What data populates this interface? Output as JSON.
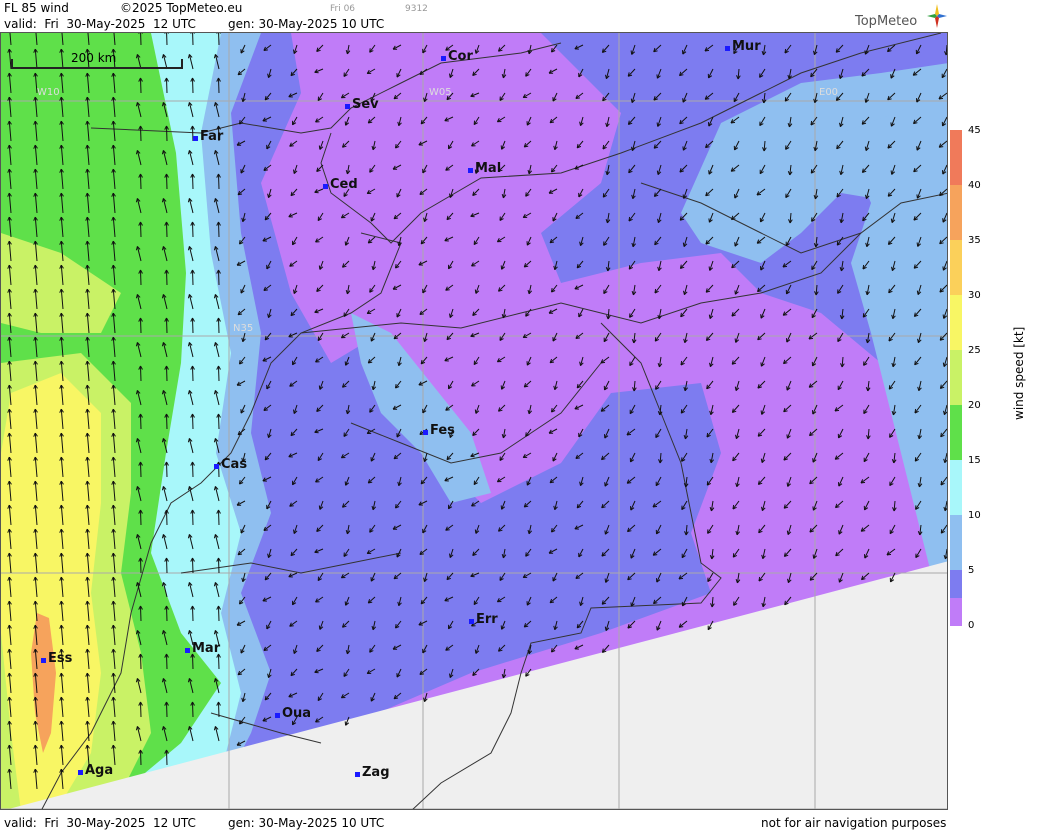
{
  "header": {
    "product": "FL 85 wind",
    "copyright": "©2025 TopMeteo.eu",
    "day_code": "Fri 06",
    "code_number": "9312",
    "valid": "valid:  Fri  30-May-2025  12 UTC",
    "gen": "gen: 30-May-2025 10 UTC"
  },
  "logo": {
    "text": "TopMeteo",
    "icon": "compass-star-icon"
  },
  "scale_bar": {
    "label": "200 km"
  },
  "grid_labels": [
    {
      "text": "W10"
    },
    {
      "text": "W05"
    },
    {
      "text": "E00"
    },
    {
      "text": "N35"
    }
  ],
  "cities": [
    {
      "name": "Cor"
    },
    {
      "name": "Mur"
    },
    {
      "name": "Sev"
    },
    {
      "name": "Far"
    },
    {
      "name": "Mal"
    },
    {
      "name": "Ced"
    },
    {
      "name": "Fes"
    },
    {
      "name": "Cas"
    },
    {
      "name": "Err"
    },
    {
      "name": "Mar"
    },
    {
      "name": "Ess"
    },
    {
      "name": "Oua"
    },
    {
      "name": "Aga"
    },
    {
      "name": "Zag"
    }
  ],
  "legend": {
    "title": "wind speed [kt]",
    "ticks": [
      "45",
      "40",
      "35",
      "30",
      "25",
      "20",
      "15",
      "10",
      "5",
      "0"
    ],
    "colors": [
      "#f07a5a",
      "#f6a35c",
      "#fbd05a",
      "#f8f664",
      "#c9f266",
      "#5fe04a",
      "#a8f7fa",
      "#8fbff0",
      "#7d7cf0",
      "#c07cf8"
    ]
  },
  "footer": {
    "valid": "valid:  Fri  30-May-2025  12 UTC",
    "gen": "gen: 30-May-2025 10 UTC",
    "disclaimer": "not for air navigation purposes"
  },
  "colors": {
    "purple": "#c07cf8",
    "blue_purple": "#7d7cf0",
    "light_blue": "#8fbff0",
    "cyan": "#a8f7fa",
    "green": "#5fe04a",
    "yellow_green": "#c9f266",
    "yellow": "#f8f664",
    "orange": "#f6a35c",
    "no_data": "#efefef"
  }
}
